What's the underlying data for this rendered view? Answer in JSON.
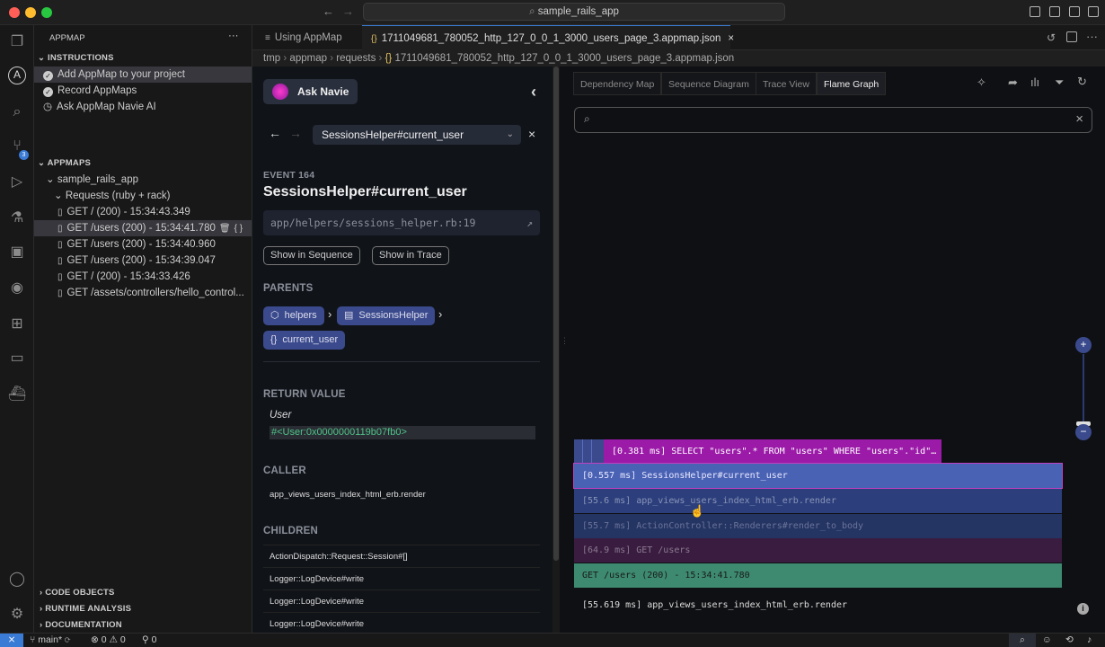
{
  "window": {
    "title": "sample_rails_app"
  },
  "sidebar": {
    "header": "APPMAP",
    "more": "···",
    "instructions": {
      "title": "INSTRUCTIONS",
      "items": [
        "Add AppMap to your project",
        "Record AppMaps",
        "Ask AppMap Navie AI"
      ]
    },
    "appmaps": {
      "title": "APPMAPS",
      "project": "sample_rails_app",
      "group": "Requests (ruby + rack)",
      "items": [
        "GET / (200) - 15:34:43.349",
        "GET /users (200) - 15:34:41.780",
        "GET /users (200) - 15:34:40.960",
        "GET /users (200) - 15:34:39.047",
        "GET / (200) - 15:34:33.426",
        "GET /assets/controllers/hello_control..."
      ]
    },
    "bottom": [
      "CODE OBJECTS",
      "RUNTIME ANALYSIS",
      "DOCUMENTATION"
    ]
  },
  "tabs": [
    {
      "label": "Using AppMap",
      "icon": "file-icon"
    },
    {
      "label": "1711049681_780052_http_127_0_0_1_3000_users_page_3.appmap.json",
      "icon": "braces-icon",
      "close": "×"
    }
  ],
  "breadcrumb": [
    "tmp",
    "appmap",
    "requests",
    "1711049681_780052_http_127_0_0_1_3000_users_page_3.appmap.json"
  ],
  "panel": {
    "ask_navie": "Ask Navie",
    "selected_function": "SessionsHelper#current_user",
    "event_label": "EVENT 164",
    "event_title": "SessionsHelper#current_user",
    "source_path": "app/helpers/sessions_helper.rb:19",
    "show_sequence": "Show in Sequence",
    "show_trace": "Show in Trace",
    "parents_label": "PARENTS",
    "parents": [
      "helpers",
      "SessionsHelper",
      "current_user"
    ],
    "return_label": "RETURN VALUE",
    "return_type": "User",
    "return_value": "#<User:0x0000000119b07fb0>",
    "caller_label": "CALLER",
    "caller": "app_views_users_index_html_erb.render",
    "children_label": "CHILDREN",
    "children": [
      "ActionDispatch::Request::Session#[]",
      "Logger::LogDevice#write",
      "Logger::LogDevice#write",
      "Logger::LogDevice#write"
    ]
  },
  "right": {
    "tabs": [
      "Dependency Map",
      "Sequence Diagram",
      "Trace View",
      "Flame Graph"
    ],
    "active_tab": "Flame Graph",
    "zoom_plus": "+",
    "zoom_minus": "−",
    "flame": [
      {
        "label": "[0.381 ms] SELECT \"users\".* FROM \"users\" WHERE \"users\".\"id\"…",
        "color": "#9b1aa8"
      },
      {
        "label": "[0.557 ms] SessionsHelper#current_user",
        "color": "#4a62b4"
      },
      {
        "label": "[55.6 ms] app_views_users_index_html_erb.render",
        "color": "#2c3f7c"
      },
      {
        "label": "[55.7 ms] ActionController::Renderers#render_to_body",
        "color": "#243463"
      },
      {
        "label": "[64.9 ms] GET /users",
        "color": "#3a1c40"
      },
      {
        "label": "GET /users (200) - 15:34:41.780",
        "color": "#3d8a70"
      }
    ],
    "hover_info": "[55.619 ms] app_views_users_index_html_erb.render"
  },
  "status": {
    "branch": "main*",
    "errors": "0",
    "warnings": "0",
    "ports": "0"
  }
}
